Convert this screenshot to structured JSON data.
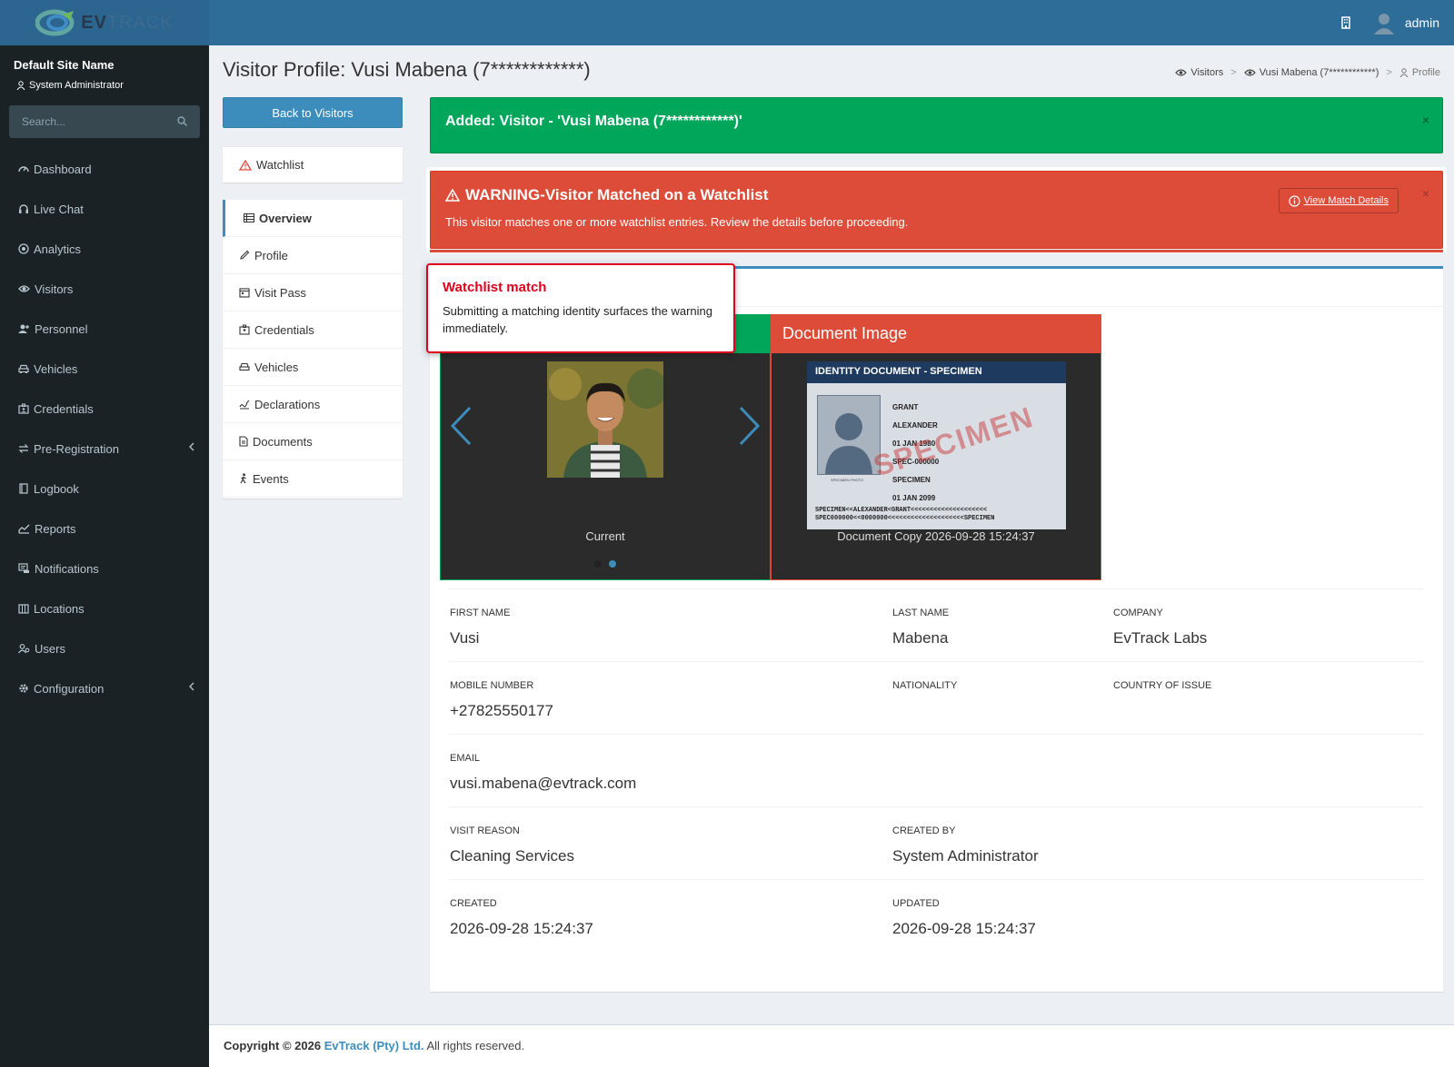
{
  "header": {
    "logo_bold": "EV",
    "logo_light": "TRACK",
    "user_name": "admin",
    "icons": [
      "building-icon",
      "user-avatar-icon"
    ]
  },
  "sidebar": {
    "site_name": "Default Site Name",
    "role": "System Administrator",
    "search_placeholder": "Search...",
    "items": [
      {
        "label": "Dashboard",
        "icon": "dashboard-icon"
      },
      {
        "label": "Live Chat",
        "icon": "headset-icon"
      },
      {
        "label": "Analytics",
        "icon": "target-icon"
      },
      {
        "label": "Visitors",
        "icon": "eye-icon"
      },
      {
        "label": "Personnel",
        "icon": "user-plus-icon"
      },
      {
        "label": "Vehicles",
        "icon": "car-icon"
      },
      {
        "label": "Credentials",
        "icon": "id-card-icon"
      },
      {
        "label": "Pre-Registration",
        "icon": "exchange-icon",
        "has_submenu": true
      },
      {
        "label": "Logbook",
        "icon": "book-icon"
      },
      {
        "label": "Reports",
        "icon": "chart-icon"
      },
      {
        "label": "Notifications",
        "icon": "bell-list-icon"
      },
      {
        "label": "Locations",
        "icon": "map-icon"
      },
      {
        "label": "Users",
        "icon": "users-icon"
      },
      {
        "label": "Configuration",
        "icon": "gear-icon",
        "has_submenu": true
      }
    ]
  },
  "page": {
    "title": "Visitor Profile: Vusi Mabena (7************)",
    "breadcrumb": {
      "visitors": "Visitors",
      "visitor": "Vusi Mabena (7************)",
      "current": "Profile"
    },
    "back_button": "Back to Visitors",
    "watchlist_label": "Watchlist",
    "menu": [
      {
        "label": "Overview",
        "active": true,
        "icon": "list-icon"
      },
      {
        "label": "Profile",
        "icon": "pencil-icon"
      },
      {
        "label": "Visit Pass",
        "icon": "calendar-icon"
      },
      {
        "label": "Credentials",
        "icon": "id-card-icon"
      },
      {
        "label": "Vehicles",
        "icon": "car-icon"
      },
      {
        "label": "Declarations",
        "icon": "signature-icon"
      },
      {
        "label": "Documents",
        "icon": "document-icon"
      },
      {
        "label": "Events",
        "icon": "walking-icon"
      }
    ]
  },
  "alerts": {
    "success": "Added: Visitor - 'Vusi Mabena (7************)'",
    "close": "×",
    "warning_title": "WARNING-Visitor Matched on a Watchlist",
    "warning_text": "This visitor matches one or more watchlist entries. Review the details before proceeding.",
    "view_match": "View Match Details"
  },
  "images": {
    "doc_title": "Document Image",
    "photo_caption": "Current",
    "doc_caption": "Document Copy 2026-09-28 15:24:37",
    "carousel_active_slide": 2,
    "carousel_total_slides": 2
  },
  "id_document": {
    "header": "IDENTITY DOCUMENT - SPECIMEN",
    "stamp": "SPECIMEN",
    "photo_label": "SPECIMEN PHOTO",
    "surname": "GRANT",
    "given_names": "ALEXANDER",
    "dob": "01 JAN 1980",
    "number": "SPEC-000000",
    "nationality": "SPECIMEN",
    "expiry": "01 JAN 2099",
    "mrz1": "SPECIMEN<<ALEXANDER<GRANT<<<<<<<<<<<<<<<<<<<<",
    "mrz2": "SPEC000000<<0000000<<<<<<<<<<<<<<<<<<<<SPECIMEN"
  },
  "fields": {
    "first_name_label": "FIRST NAME",
    "first_name": "Vusi",
    "last_name_label": "LAST NAME",
    "last_name": "Mabena",
    "company_label": "COMPANY",
    "company": "EvTrack Labs",
    "mobile_label": "MOBILE NUMBER",
    "mobile": "+27825550177",
    "nationality_label": "NATIONALITY",
    "country_label": "COUNTRY OF ISSUE",
    "email_label": "EMAIL",
    "email": "vusi.mabena@evtrack.com",
    "visit_reason_label": "VISIT REASON",
    "visit_reason": "Cleaning Services",
    "created_by_label": "CREATED BY",
    "created_by": "System Administrator",
    "created_label": "CREATED",
    "created": "2026-09-28 15:24:37",
    "updated_label": "UPDATED",
    "updated": "2026-09-28 15:24:37"
  },
  "footer": {
    "prefix": "Copyright © 2026",
    "company": "EvTrack (Pty) Ltd.",
    "suffix": "All rights reserved."
  },
  "tooltip": {
    "title": "Watchlist match",
    "text": "Submitting a matching identity surfaces the warning immediately."
  },
  "colors": {
    "topbar": "#2f6d99",
    "sidebar": "#1a2226",
    "primary": "#3c8dbc",
    "success": "#00a65a",
    "danger": "#dd4b39",
    "tooltip_accent": "#e0001b"
  }
}
